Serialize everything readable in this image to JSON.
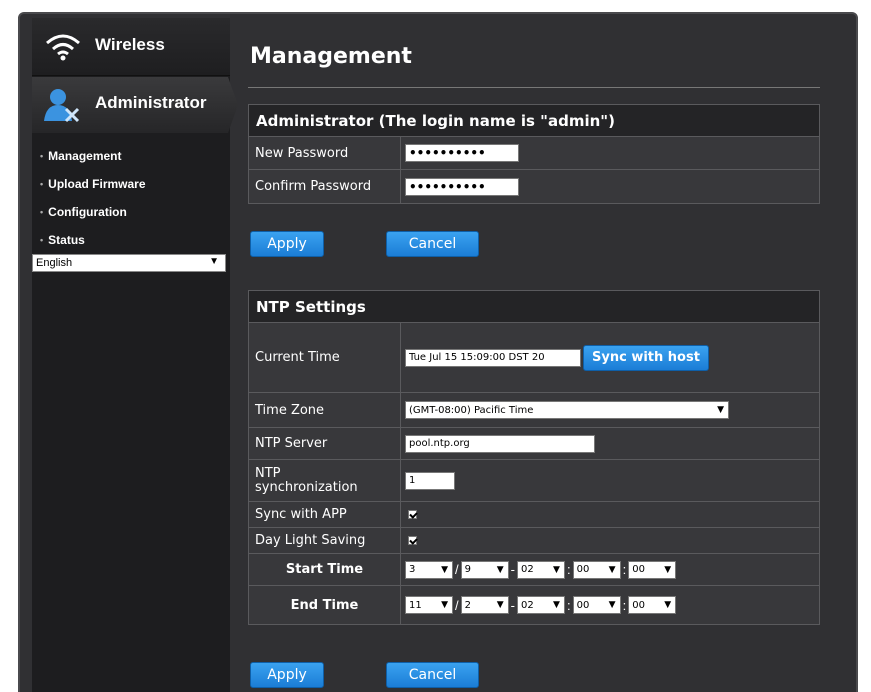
{
  "nav": {
    "wireless_label": "Wireless",
    "admin_label": "Administrator",
    "submenu": [
      "Management",
      "Upload Firmware",
      "Configuration",
      "Status"
    ],
    "language": "English"
  },
  "page": {
    "title": "Management"
  },
  "admin_panel": {
    "heading": "Administrator (The login name is \"admin\")",
    "new_password_label": "New Password",
    "new_password_mask": "••••••••••",
    "confirm_password_label": "Confirm Password",
    "confirm_password_mask": "••••••••••",
    "apply_label": "Apply",
    "cancel_label": "Cancel"
  },
  "ntp_panel": {
    "heading": "NTP Settings",
    "current_time_label": "Current Time",
    "current_time_value": "Tue Jul 15 15:09:00 DST 20",
    "sync_host_label": "Sync with host",
    "timezone_label": "Time Zone",
    "timezone_value": "(GMT-08:00) Pacific Time",
    "server_label": "NTP Server",
    "server_value": "pool.ntp.org",
    "sync_label_line1": "NTP",
    "sync_label_line2": "synchronization",
    "sync_value": "1",
    "sync_app_label": "Sync with APP",
    "dst_label": "Day Light Saving",
    "start_label": "Start Time",
    "start": {
      "month": "3",
      "day": "9",
      "hour": "02",
      "min": "00",
      "sec": "00"
    },
    "end_label": "End Time",
    "end": {
      "month": "11",
      "day": "2",
      "hour": "02",
      "min": "00",
      "sec": "00"
    },
    "apply_label": "Apply",
    "cancel_label": "Cancel"
  },
  "colors": {
    "accent": "#1b7dd6",
    "panel": "#38383b",
    "sidebar": "#1d1d1f"
  }
}
